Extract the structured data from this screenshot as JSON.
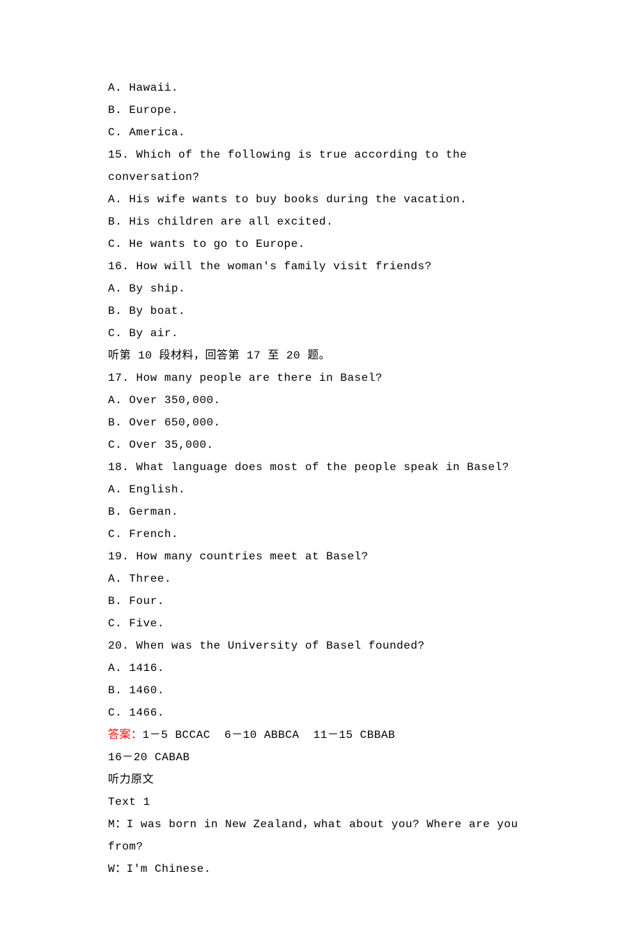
{
  "lines": {
    "l1": "A. Hawaii.",
    "l2": "B. Europe.",
    "l3": "C. America.",
    "q15": "15. Which of the following is true according to the conversation?",
    "q15a": "A. His wife wants to buy books during the vacation.",
    "q15b": "B. His children are all excited.",
    "q15c": "C. He wants to go to Europe.",
    "q16": "16. How will the woman's family visit friends?",
    "q16a": "A. By ship.",
    "q16b": "B. By boat.",
    "q16c": "C. By air.",
    "section10": "听第 10 段材料，回答第 17 至 20 题。",
    "q17": "17. How many people are there in Basel?",
    "q17a": "A. Over 350,000.",
    "q17b": "B. Over 650,000.",
    "q17c": "C. Over 35,000.",
    "q18": "18. What language does most of the people speak in Basel?",
    "q18a": "A. English.",
    "q18b": "B. German.",
    "q18c": "C. French.",
    "q19": "19. How many countries meet at Basel?",
    "q19a": "A. Three.",
    "q19b": "B. Four.",
    "q19c": "C. Five.",
    "q20": "20. When was the University of Basel founded?",
    "q20a": "A. 1416.",
    "q20b": "B. 1460.",
    "q20c": "C. 1466.",
    "answer_label": "答案：",
    "answer_text": "1－5 BCCAC  6－10 ABBCA  11－15 CBBAB",
    "answer_line2": "16－20 CABAB",
    "transcript_header": "听力原文",
    "text1": "Text 1",
    "text1_m": "M：I was born in New Zealand，what about you? Where are you from?",
    "text1_w": "W：I'm Chinese."
  }
}
